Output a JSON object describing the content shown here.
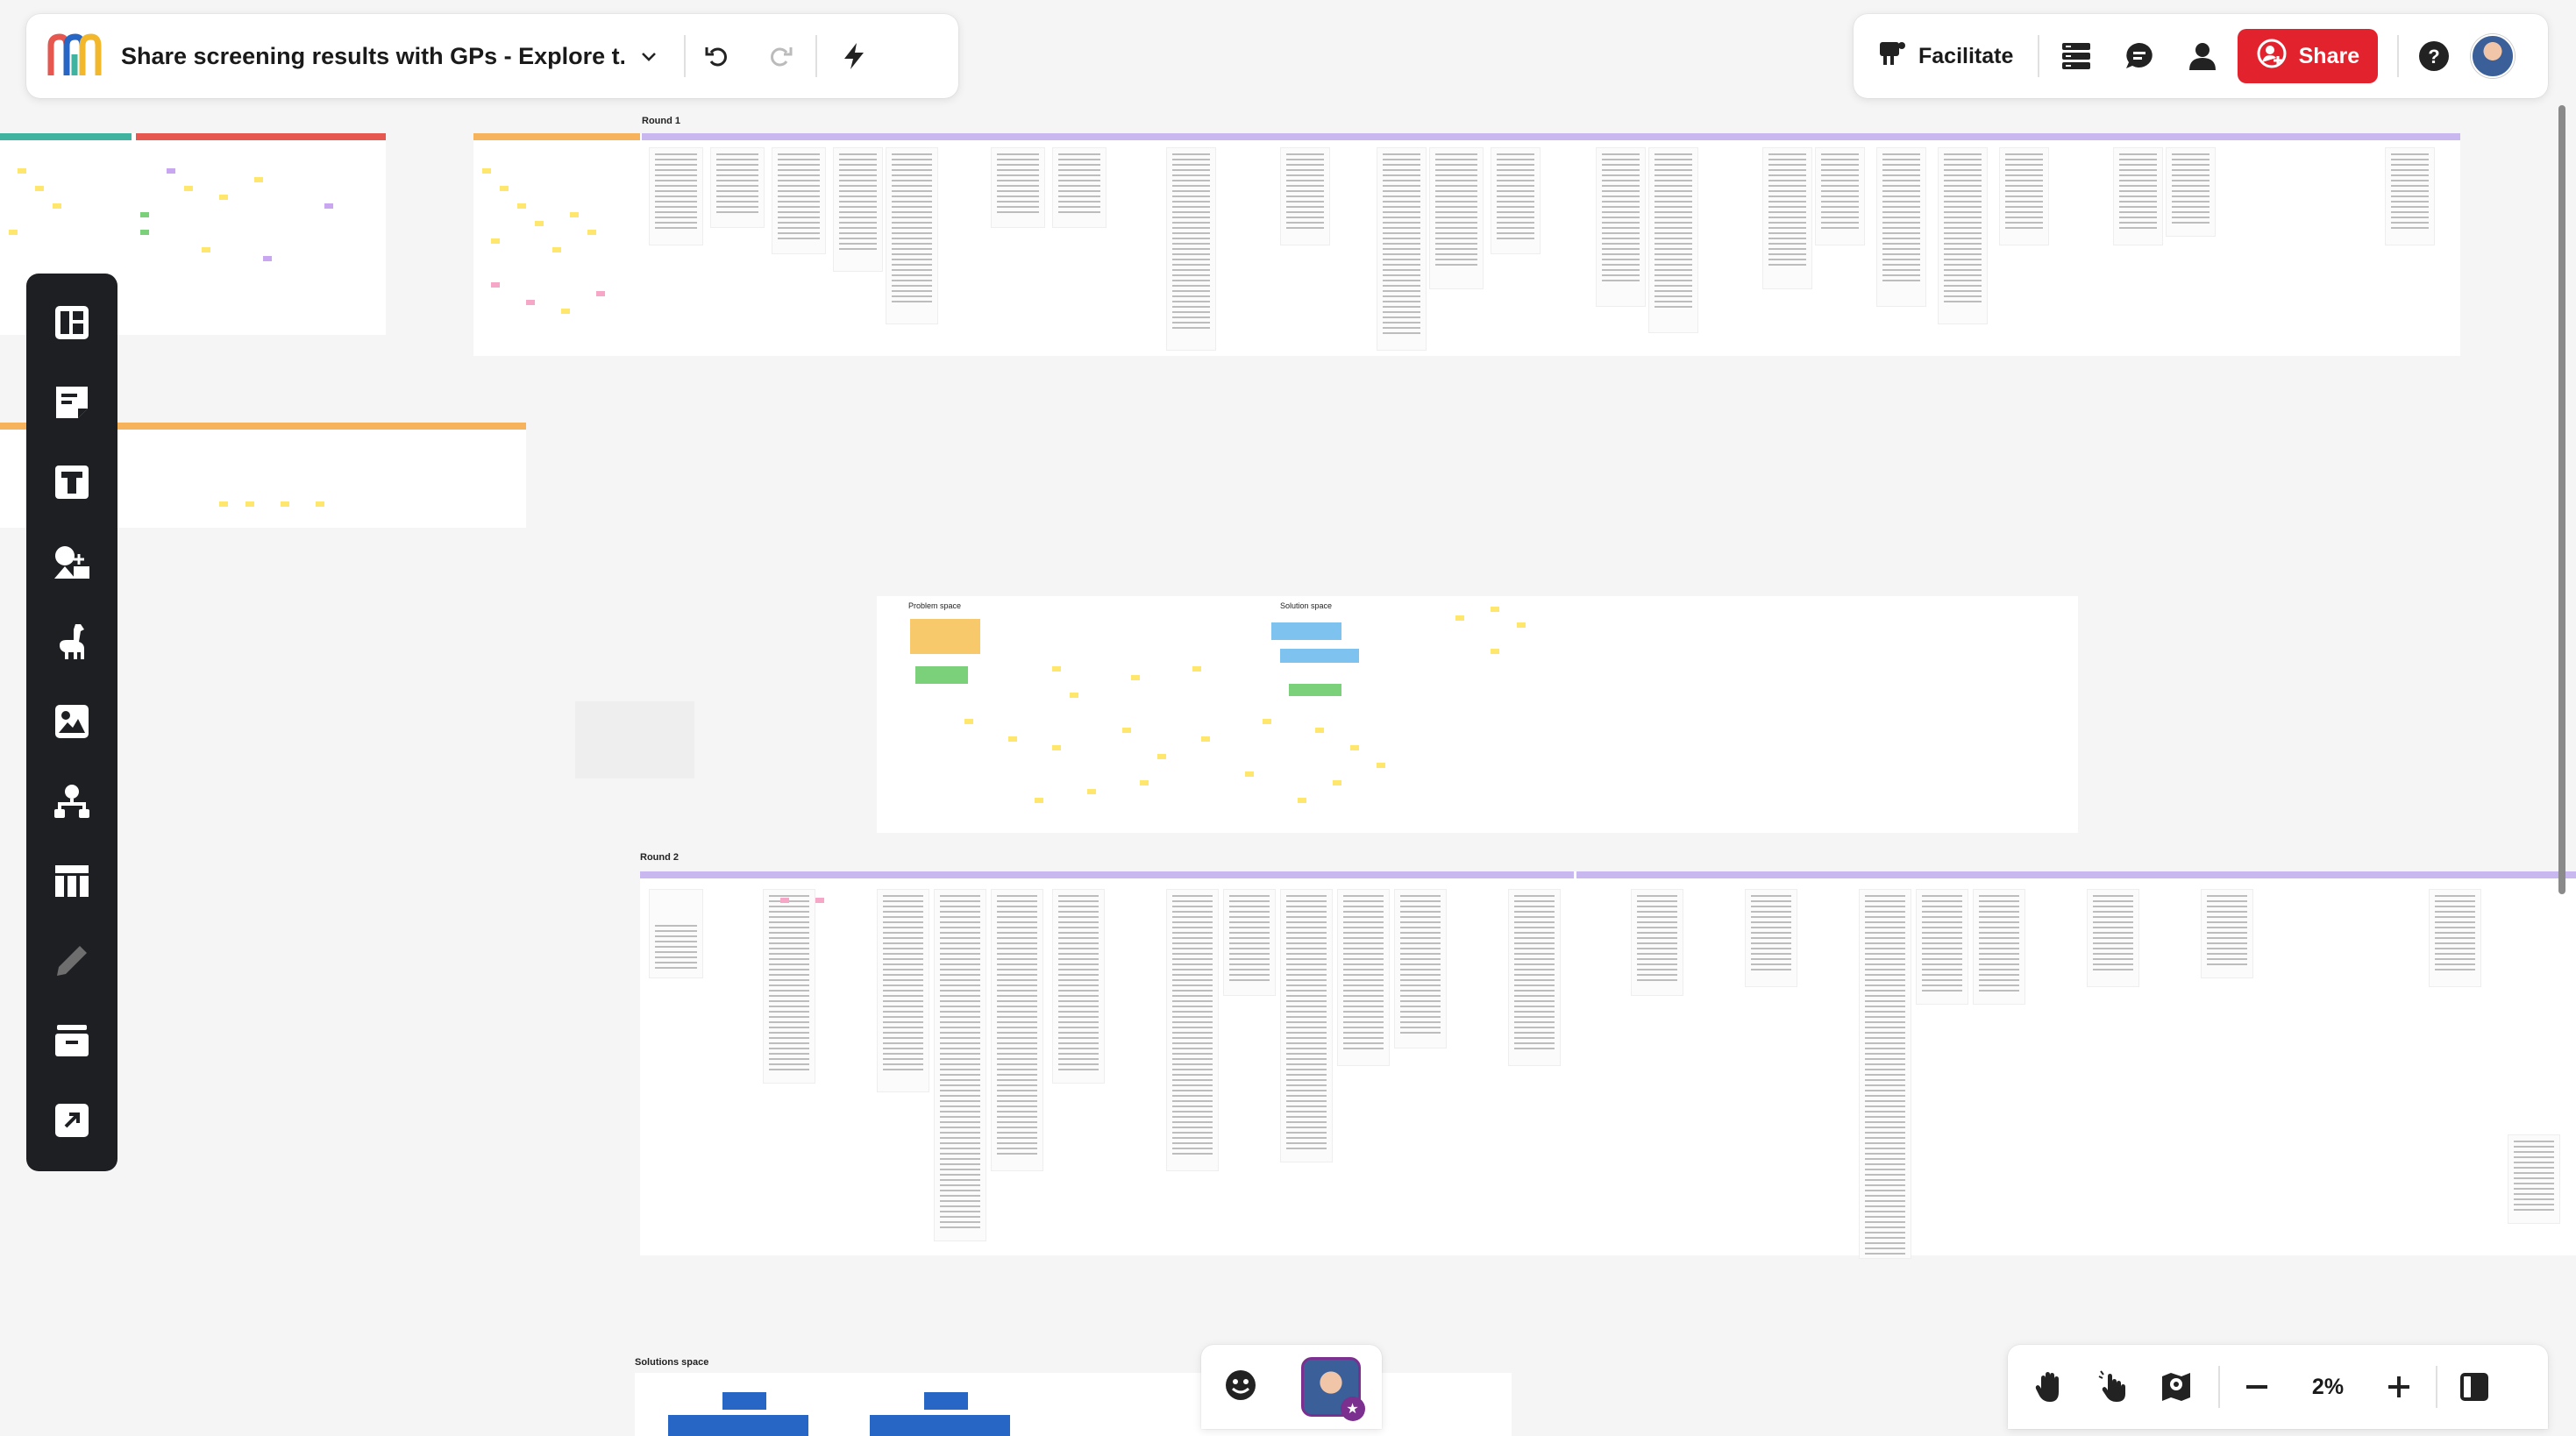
{
  "app": {
    "board_title": "Share screening results with GPs - Explore t...",
    "logo_icon": "miro-logo-icon"
  },
  "header": {
    "dropdown_icon": "chevron-down-icon",
    "undo_icon": "undo-icon",
    "redo_icon": "redo-icon",
    "quick_actions_icon": "lightning-icon"
  },
  "toolbar_right": {
    "facilitate_label": "Facilitate",
    "share_label": "Share",
    "icons": [
      "board-list-icon",
      "comments-icon",
      "collaborators-icon",
      "help-icon"
    ]
  },
  "left_toolbar": {
    "tools": [
      "templates-icon",
      "sticky-note-icon",
      "text-icon",
      "shapes-icon",
      "llama-icon",
      "image-icon",
      "mind-map-icon",
      "table-icon",
      "pen-icon",
      "kanban-icon",
      "upload-icon"
    ]
  },
  "bottom_right": {
    "zoom_level": "2%"
  },
  "board": {
    "labels": {
      "round1": "Round 1",
      "round2": "Round 2",
      "problem_space": "Problem space",
      "solution_space": "Solution space",
      "solutions_space": "Solutions space"
    }
  },
  "colors": {
    "share_red": "#e2232e",
    "toolbar_dark": "#1d1f22",
    "header_purple": "#c9b7f0",
    "header_orange": "#f7b35c",
    "sticky_yellow": "#ffe66d"
  }
}
